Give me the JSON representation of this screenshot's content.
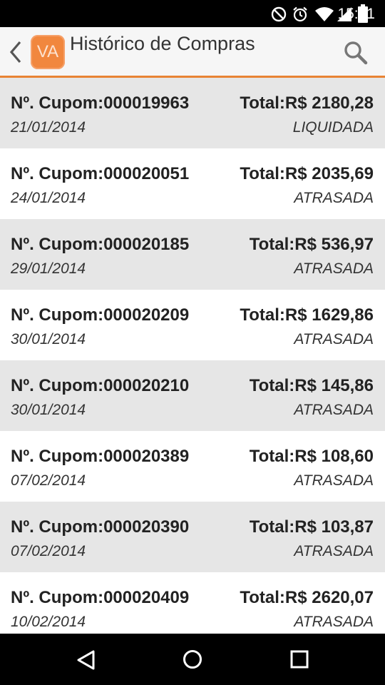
{
  "status_bar": {
    "time": "15:21",
    "icons": [
      "do-not-disturb-icon",
      "alarm-icon",
      "wifi-icon",
      "cell-signal-icon",
      "battery-icon"
    ]
  },
  "action_bar": {
    "logo_text": "VA",
    "title": "Histórico de Compras",
    "accent_color": "#e98434"
  },
  "purchases": [
    {
      "coupon": "Nº. Cupom:000019963",
      "total": "Total:R$ 2180,28",
      "date": "21/01/2014",
      "status": "LIQUIDADA"
    },
    {
      "coupon": "Nº. Cupom:000020051",
      "total": "Total:R$ 2035,69",
      "date": "24/01/2014",
      "status": "ATRASADA"
    },
    {
      "coupon": "Nº. Cupom:000020185",
      "total": "Total:R$ 536,97",
      "date": "29/01/2014",
      "status": "ATRASADA"
    },
    {
      "coupon": "Nº. Cupom:000020209",
      "total": "Total:R$ 1629,86",
      "date": "30/01/2014",
      "status": "ATRASADA"
    },
    {
      "coupon": "Nº. Cupom:000020210",
      "total": "Total:R$ 145,86",
      "date": "30/01/2014",
      "status": "ATRASADA"
    },
    {
      "coupon": "Nº. Cupom:000020389",
      "total": "Total:R$ 108,60",
      "date": "07/02/2014",
      "status": "ATRASADA"
    },
    {
      "coupon": "Nº. Cupom:000020390",
      "total": "Total:R$ 103,87",
      "date": "07/02/2014",
      "status": "ATRASADA"
    },
    {
      "coupon": "Nº. Cupom:000020409",
      "total": "Total:R$ 2620,07",
      "date": "10/02/2014",
      "status": "ATRASADA"
    }
  ],
  "nav_bar": {
    "icons": [
      "back-triangle-icon",
      "home-circle-icon",
      "recents-square-icon"
    ]
  }
}
